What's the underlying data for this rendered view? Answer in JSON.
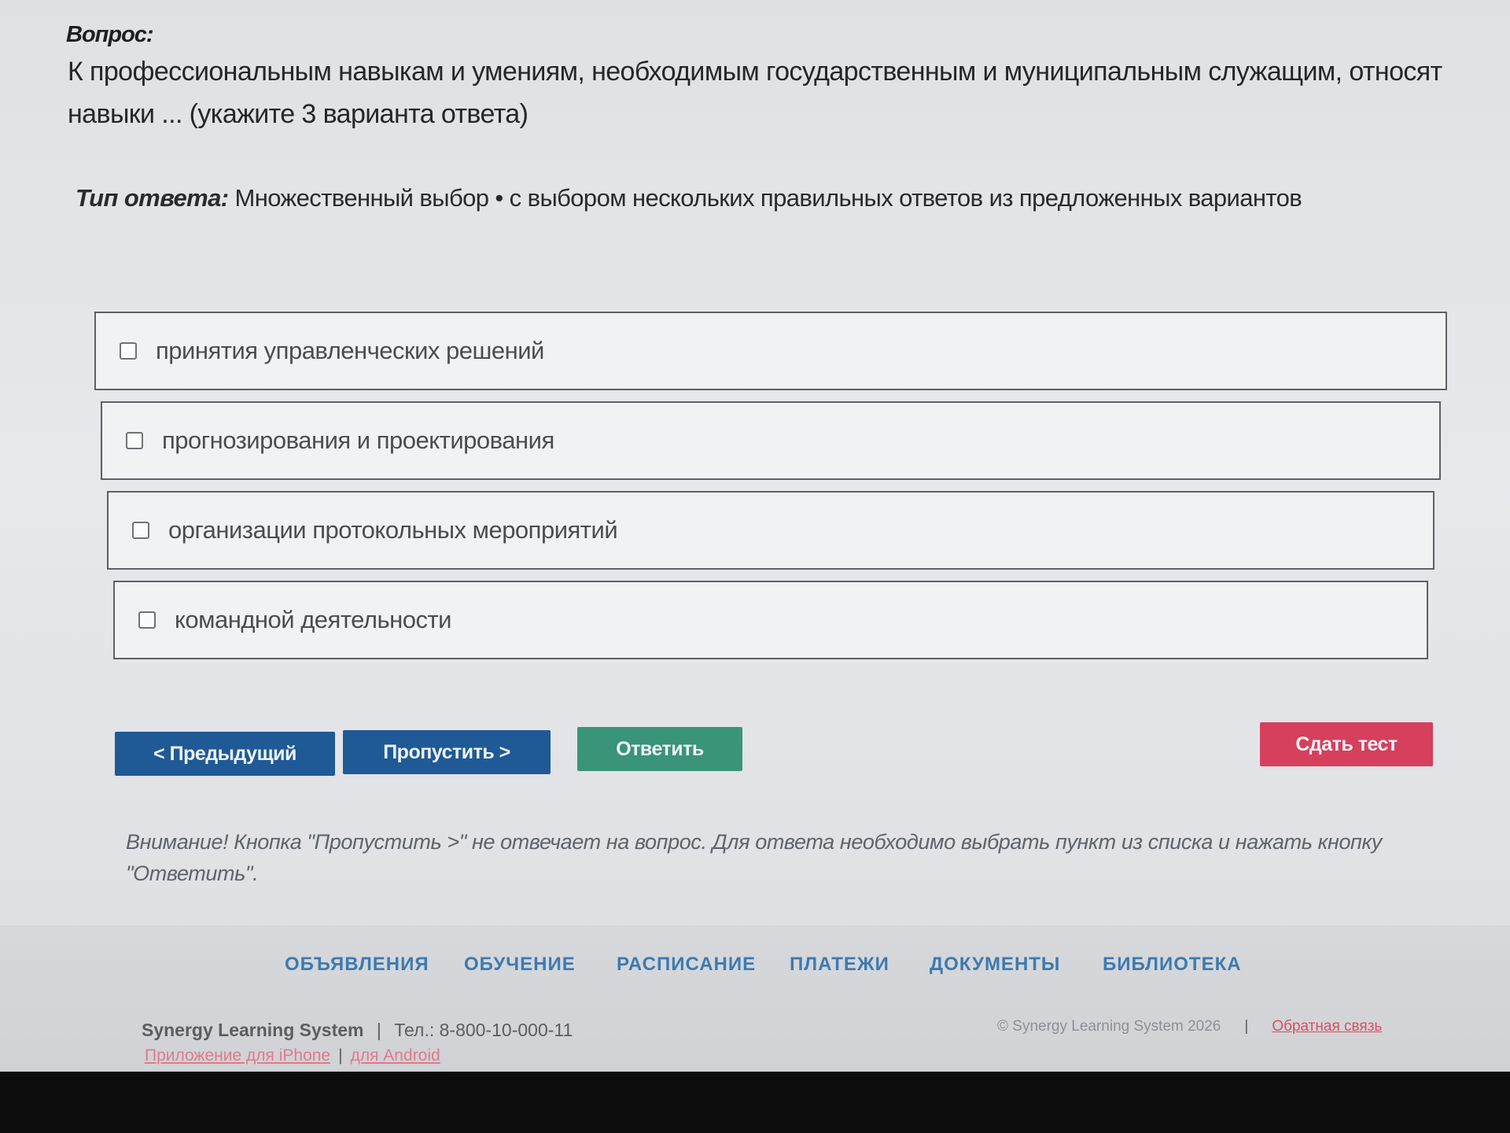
{
  "question": {
    "label": "Вопрос:",
    "text": "К профессиональным навыкам и умениям, необходимым государственным и муниципальным служащим, относят навыки ... (укажите 3 варианта ответа)"
  },
  "answer_type": {
    "label": "Тип ответа:",
    "value": "Множественный выбор • с выбором нескольких правильных ответов из предложенных вариантов"
  },
  "options": [
    {
      "label": "принятия управленческих решений",
      "checked": false
    },
    {
      "label": "прогнозирования и проектирования",
      "checked": false
    },
    {
      "label": "организации протокольных мероприятий",
      "checked": false
    },
    {
      "label": "командной деятельности",
      "checked": false
    }
  ],
  "buttons": {
    "prev": "< Предыдущий",
    "skip": "Пропустить >",
    "answer": "Ответить",
    "submit": "Сдать тест"
  },
  "warning": "Внимание! Кнопка \"Пропустить >\" не отвечает на вопрос. Для ответа необходимо выбрать пункт из списка и нажать кнопку \"Ответить\".",
  "nav": [
    "ОБЪЯВЛЕНИЯ",
    "ОБУЧЕНИЕ",
    "РАСПИСАНИЕ",
    "ПЛАТЕЖИ",
    "ДОКУМЕНТЫ",
    "БИБЛИОТЕКА"
  ],
  "footer": {
    "brand": "Synergy Learning System",
    "phone": "Тел.: 8-800-10-000-11",
    "app_iphone": "Приложение для iPhone",
    "app_android": "для Android",
    "copyright": "© Synergy Learning System 2026",
    "feedback": "Обратная связь"
  },
  "colors": {
    "primary_blue": "#1f5a96",
    "answer_green": "#3a9479",
    "submit_red": "#d6405c",
    "nav_blue": "#3d7ab0"
  }
}
